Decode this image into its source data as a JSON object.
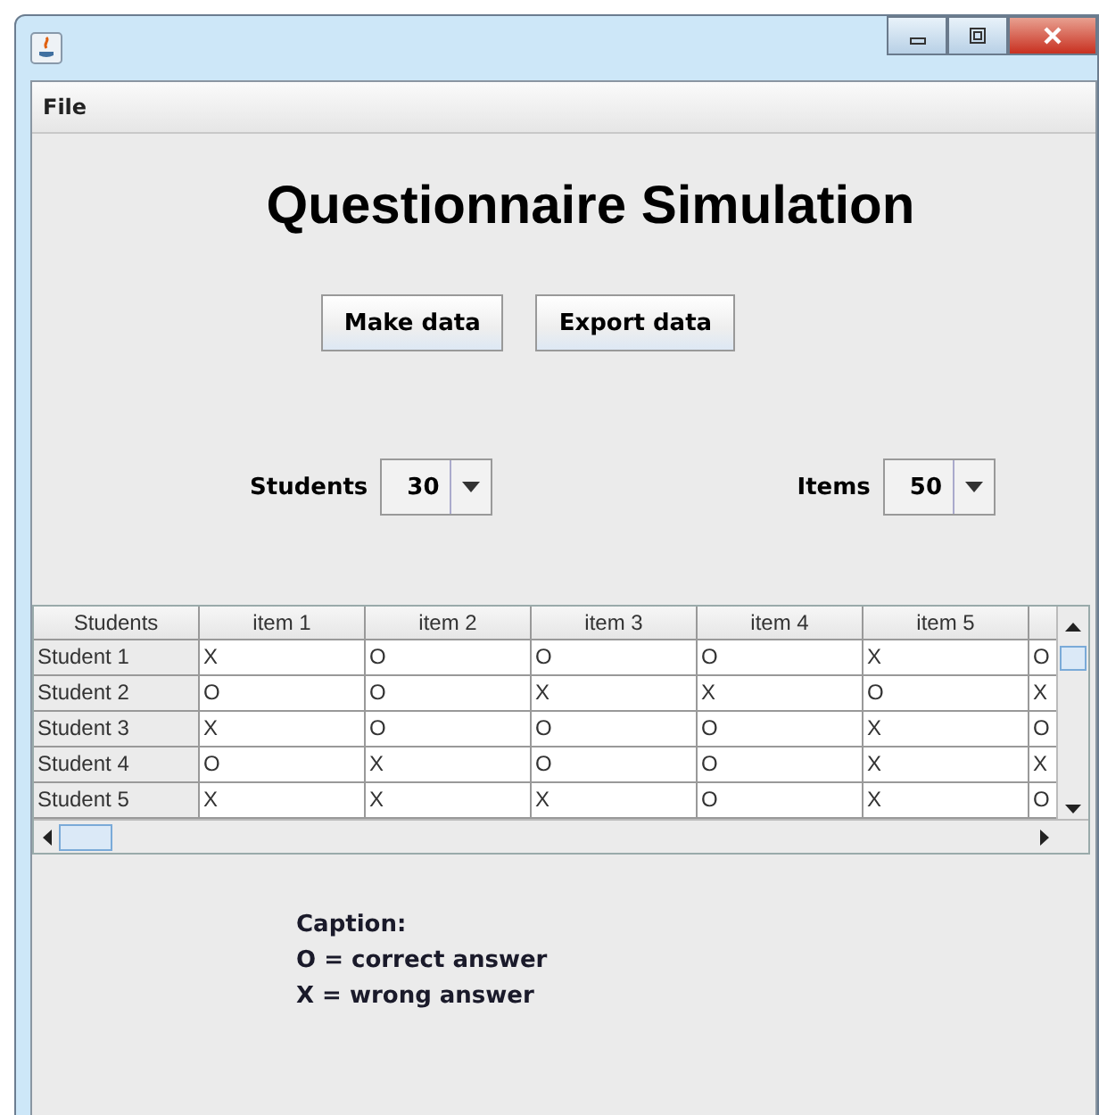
{
  "menu": [
    "File"
  ],
  "title": "Questionnaire Simulation",
  "buttons": [
    "Make data",
    "Export data"
  ],
  "combos": [
    {
      "label": "Students",
      "value": "30"
    },
    {
      "label": "Items",
      "value": "50"
    }
  ],
  "table": {
    "columns": [
      "Students",
      "item 1",
      "item 2",
      "item 3",
      "item 4",
      "item 5"
    ],
    "rows": [
      [
        "Student 1",
        "X",
        "O",
        "O",
        "O",
        "X",
        "O"
      ],
      [
        "Student 2",
        "O",
        "O",
        "X",
        "X",
        "O",
        "X"
      ],
      [
        "Student 3",
        "X",
        "O",
        "O",
        "O",
        "X",
        "O"
      ],
      [
        "Student 4",
        "O",
        "X",
        "O",
        "O",
        "X",
        "X"
      ],
      [
        "Student 5",
        "X",
        "X",
        "X",
        "O",
        "X",
        "O"
      ]
    ]
  },
  "caption": [
    "Caption:",
    "O = correct answer",
    "X = wrong answer"
  ]
}
